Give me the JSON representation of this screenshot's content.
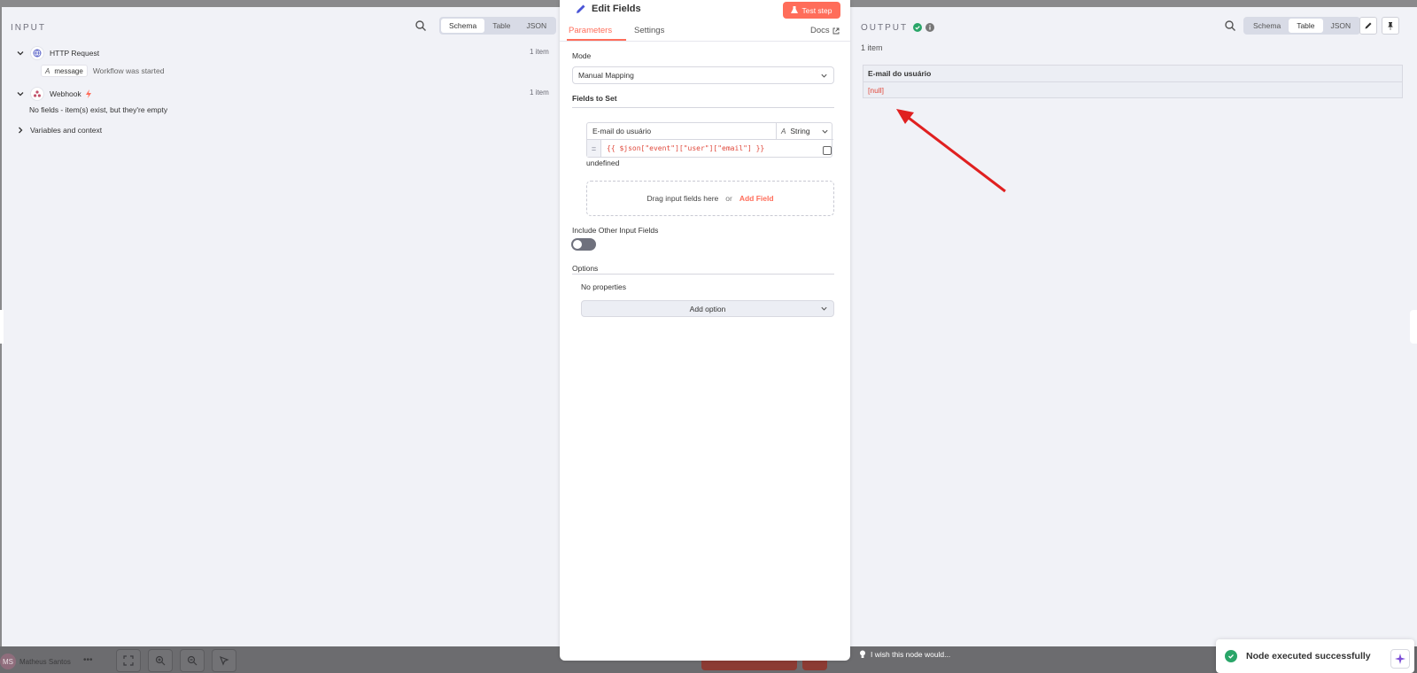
{
  "input": {
    "title": "INPUT",
    "view_tabs": [
      "Schema",
      "Table",
      "JSON"
    ],
    "active_view": "Schema",
    "nodes": [
      {
        "name": "HTTP Request",
        "count": "1 item",
        "field_key": "message",
        "field_value": "Workflow was started"
      },
      {
        "name": "Webhook",
        "count": "1 item",
        "empty_text": "No fields - item(s) exist, but they're empty"
      }
    ],
    "variables_label": "Variables and context"
  },
  "center": {
    "title": "Edit Fields",
    "test_button": "Test step",
    "tabs": [
      "Parameters",
      "Settings"
    ],
    "active_tab": "Parameters",
    "docs": "Docs",
    "mode_label": "Mode",
    "mode_value": "Manual Mapping",
    "fields_label": "Fields to Set",
    "field_name": "E-mail do usuário",
    "field_type": "String",
    "field_eq": "=",
    "field_expression": "{{ $json[\"event\"][\"user\"][\"email\"] }}",
    "field_result": "undefined",
    "drop_text": "Drag input fields here",
    "drop_or": "or",
    "add_field": "Add Field",
    "include_label": "Include Other Input Fields",
    "include_on": false,
    "options_label": "Options",
    "no_properties": "No properties",
    "add_option": "Add option"
  },
  "output": {
    "title": "OUTPUT",
    "status": "success",
    "view_tabs": [
      "Schema",
      "Table",
      "JSON"
    ],
    "active_view": "Table",
    "count": "1 item",
    "column": "E-mail do usuário",
    "value": "[null]"
  },
  "footer": {
    "avatar": "MS",
    "user": "Matheus Santos",
    "more": "•••",
    "wish": "I wish this node would..."
  },
  "toast": {
    "message": "Node executed successfully"
  },
  "colors": {
    "accent": "#ff6d5a",
    "success": "#29a568",
    "annotation_arrow": "#e02020"
  }
}
